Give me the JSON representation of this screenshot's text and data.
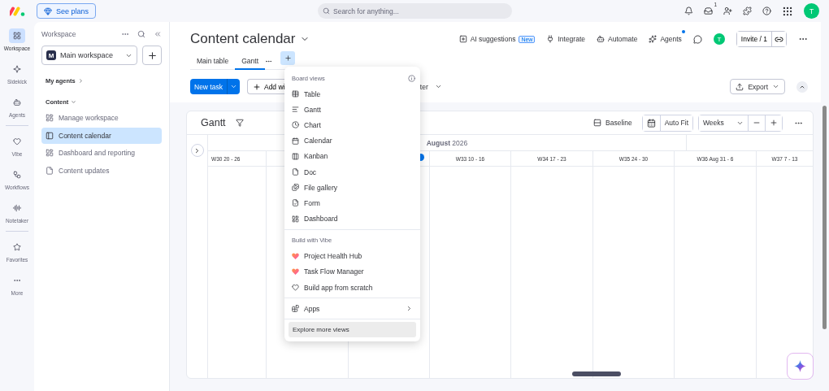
{
  "top_bar": {
    "see_plans": "See plans",
    "search": {
      "placeholder": "Search for anything..."
    },
    "inbox_badge": "1",
    "avatar": "T"
  },
  "rail": [
    [
      {
        "label": "Workspace",
        "selected": true
      },
      {
        "label": "Sidekick",
        "selected": false
      },
      {
        "label": "Agents",
        "selected": false
      }
    ],
    [
      {
        "label": "Vibe",
        "selected": false
      },
      {
        "label": "Workflows",
        "selected": false
      },
      {
        "label": "Notetaker",
        "selected": false
      }
    ],
    [
      {
        "label": "Favorites",
        "selected": false
      },
      {
        "label": "More",
        "selected": false
      }
    ]
  ],
  "sidebar": {
    "title": "Workspace",
    "workspace": {
      "initial": "M",
      "name": "Main workspace"
    },
    "sections": [
      {
        "label": "My agents",
        "expanded": false
      },
      {
        "label": "Content",
        "expanded": true,
        "items": [
          {
            "label": "Manage workspace",
            "selected": false
          },
          {
            "label": "Content calendar",
            "selected": true
          },
          {
            "label": "Dashboard and reporting",
            "selected": false
          },
          {
            "label": "Content updates",
            "selected": false
          }
        ]
      }
    ]
  },
  "board": {
    "title": "Content calendar",
    "actions": [
      {
        "label": "AI suggestions",
        "badge": "New",
        "notification": false
      },
      {
        "label": "Integrate",
        "notification": false
      },
      {
        "label": "Automate",
        "notification": false
      },
      {
        "label": "Agents",
        "notification": true
      }
    ],
    "avatar": "T",
    "invite": "Invite / 1",
    "tabs": [
      {
        "label": "Main table",
        "selected": false
      },
      {
        "label": "Gantt",
        "selected": true
      }
    ]
  },
  "toolbar": {
    "new_task": "New task",
    "add_widget": "Add wi",
    "filter": "lter",
    "export": "Export"
  },
  "gantt": {
    "title": "Gantt",
    "baseline": "Baseline",
    "auto_fit": "Auto Fit",
    "scale": "Weeks",
    "month": "**August** 2026",
    "weeks": [
      "W30 20 - 26",
      "W33 10 - 16",
      "W34 17 - 23",
      "W35 24 - 30",
      "W36 Aug 31 - 6",
      "W37 7 - 13"
    ]
  },
  "menu": {
    "sections": [
      {
        "title": "Board views",
        "items": [
          {
            "label": "Table"
          },
          {
            "label": "Gantt"
          },
          {
            "label": "Chart"
          },
          {
            "label": "Calendar"
          },
          {
            "label": "Kanban"
          },
          {
            "label": "Doc"
          },
          {
            "label": "File gallery"
          },
          {
            "label": "Form"
          },
          {
            "label": "Dashboard"
          }
        ]
      },
      {
        "title": "Build with Vibe",
        "items": [
          {
            "label": "Project Health Hub"
          },
          {
            "label": "Task Flow Manager"
          },
          {
            "label": "Build app from scratch"
          }
        ]
      },
      {
        "items": [
          {
            "label": "Apps",
            "submenu": true
          }
        ]
      }
    ],
    "footer": {
      "label": "Explore more views",
      "selected": true
    }
  }
}
